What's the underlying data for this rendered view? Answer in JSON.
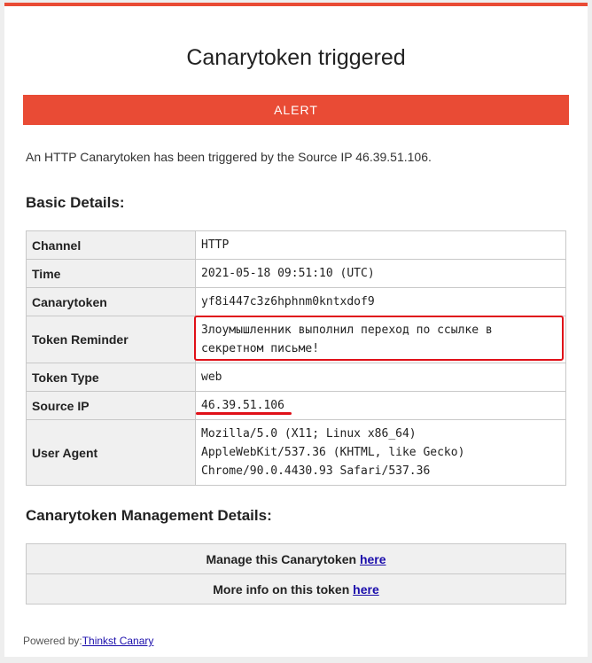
{
  "header": {
    "title": "Canarytoken triggered",
    "alert_label": "ALERT"
  },
  "intro_text": "An HTTP Canarytoken has been triggered by the Source IP 46.39.51.106.",
  "basic_details": {
    "heading": "Basic Details:",
    "rows": [
      {
        "label": "Channel",
        "value": "HTTP"
      },
      {
        "label": "Time",
        "value": "2021-05-18 09:51:10 (UTC)"
      },
      {
        "label": "Canarytoken",
        "value": "yf8i447c3z6hphnm0kntxdof9"
      },
      {
        "label": "Token Reminder",
        "value_lines": [
          "Злоумышленник выполнил переход по ссылке в",
          "секретном письме!"
        ]
      },
      {
        "label": "Token Type",
        "value": "web"
      },
      {
        "label": "Source IP",
        "value": "46.39.51.106"
      },
      {
        "label": "User Agent",
        "value_lines": [
          "Mozilla/5.0 (X11; Linux x86_64)",
          "AppleWebKit/537.36 (KHTML, like Gecko)",
          "Chrome/90.0.4430.93 Safari/537.36"
        ]
      }
    ]
  },
  "management": {
    "heading": "Canarytoken Management Details:",
    "manage_text": "Manage this Canarytoken ",
    "manage_link": "here",
    "info_text": "More info on this token ",
    "info_link": "here"
  },
  "footer": {
    "powered_by": "Powered by:",
    "link": "Thinkst Canary"
  },
  "colors": {
    "accent": "#e94b35",
    "highlight": "#e01018",
    "link": "#1a0dab"
  }
}
